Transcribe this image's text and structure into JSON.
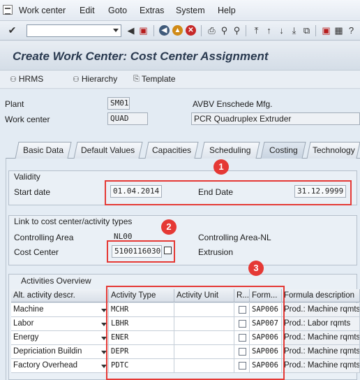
{
  "menu": [
    "Work center",
    "Edit",
    "Goto",
    "Extras",
    "System",
    "Help"
  ],
  "title": "Create Work Center: Cost Center Assignment",
  "app_buttons": [
    "HRMS",
    "Hierarchy",
    "Template"
  ],
  "plant": {
    "label": "Plant",
    "value": "SM01",
    "description": "AVBV Enschede Mfg."
  },
  "work_center": {
    "label": "Work center",
    "value": "QUAD",
    "description": "PCR Quadruplex Extruder"
  },
  "tabs": [
    "Basic Data",
    "Default Values",
    "Capacities",
    "Scheduling",
    "Costing",
    "Technology"
  ],
  "active_tab": "Costing",
  "validity": {
    "title": "Validity",
    "start_label": "Start date",
    "start_value": "01.04.2014",
    "end_label": "End Date",
    "end_value": "31.12.9999"
  },
  "link": {
    "title": "Link to cost center/activity types",
    "controlling_area_label": "Controlling Area",
    "controlling_area_value": "NL00",
    "controlling_area_desc": "Controlling Area-NL",
    "cost_center_label": "Cost Center",
    "cost_center_value": "5100116030",
    "cost_center_desc": "Extrusion"
  },
  "activities": {
    "title": "Activities Overview",
    "headers": [
      "Alt. activity descr.",
      "Activity Type",
      "Activity Unit",
      "R...",
      "Form...",
      "Formula description"
    ],
    "rows": [
      {
        "descr": "Machine",
        "type": "MCHR",
        "unit": "",
        "formula": "SAP006",
        "formula_desc": "Prod.: Machine rqmts"
      },
      {
        "descr": "Labor",
        "type": "LBHR",
        "unit": "",
        "formula": "SAP007",
        "formula_desc": "Prod.: Labor rqmts"
      },
      {
        "descr": "Energy",
        "type": "ENER",
        "unit": "",
        "formula": "SAP006",
        "formula_desc": "Prod.: Machine rqmts"
      },
      {
        "descr": "Depriciation Buildin",
        "type": "DEPR",
        "unit": "",
        "formula": "SAP006",
        "formula_desc": "Prod.: Machine rqmts"
      },
      {
        "descr": "Factory Overhead",
        "type": "PDTC",
        "unit": "",
        "formula": "SAP006",
        "formula_desc": "Prod.: Machine rqmts"
      }
    ]
  },
  "annotations": [
    "1",
    "2",
    "3"
  ],
  "colors": {
    "annotation": "#e53935",
    "title_text": "#2a3a50"
  }
}
